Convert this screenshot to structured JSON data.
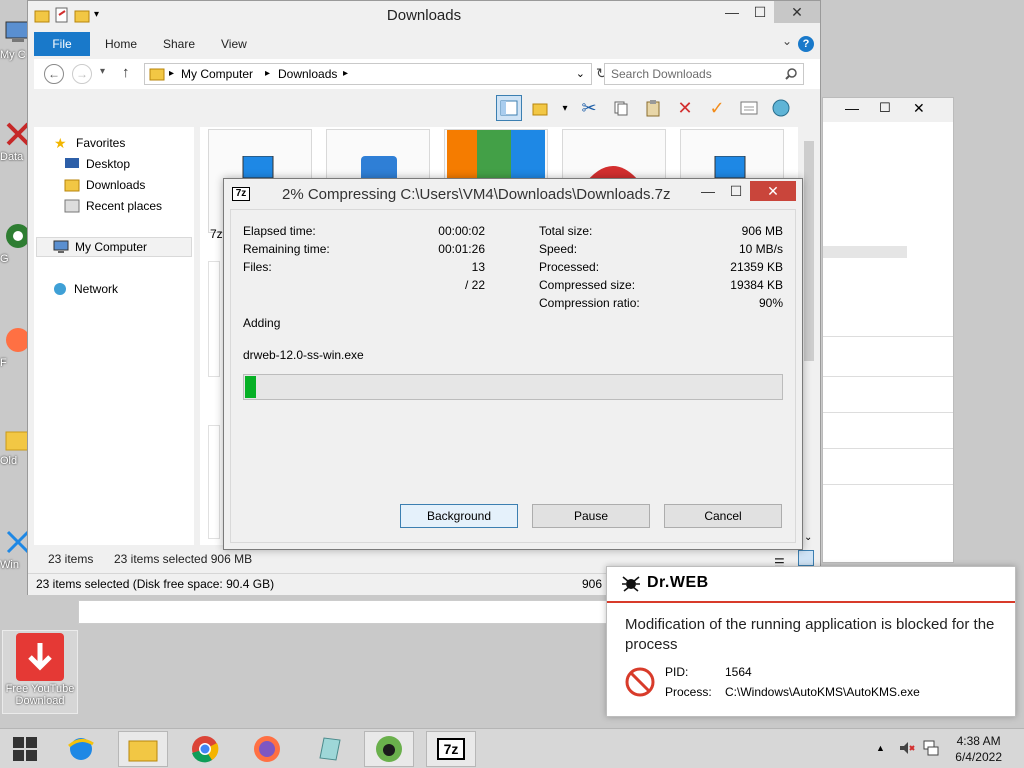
{
  "desktop": {
    "icons": [
      "My C",
      "Data",
      "G",
      "F",
      "Old",
      "Win"
    ],
    "youtube_label": "Free YouTube Download"
  },
  "explorer": {
    "title": "Downloads",
    "ribbon_tabs": [
      "File",
      "Home",
      "Share",
      "View"
    ],
    "address": {
      "crumb1": "My Computer",
      "crumb2": "Downloads"
    },
    "search_placeholder": "Search Downloads",
    "nav": {
      "favorites": "Favorites",
      "desktop": "Desktop",
      "downloads": "Downloads",
      "recent": "Recent places",
      "my_computer": "My Computer",
      "network": "Network"
    },
    "partial_label": "7z",
    "status_items": "23 items",
    "status_selected": "23 items selected  906 MB",
    "status_bar_left": "23 items selected (Disk free space: 90.4 GB)",
    "status_bar_right": "906 I"
  },
  "sevenzip": {
    "title": "2% Compressing C:\\Users\\VM4\\Downloads\\Downloads.7z",
    "logo": "7z",
    "left": {
      "elapsed_label": "Elapsed time:",
      "elapsed_value": "00:00:02",
      "remaining_label": "Remaining time:",
      "remaining_value": "00:01:26",
      "files_label": "Files:",
      "files_value": "13",
      "files_total": "/ 22"
    },
    "right": {
      "total_label": "Total size:",
      "total_value": "906 MB",
      "speed_label": "Speed:",
      "speed_value": "10 MB/s",
      "processed_label": "Processed:",
      "processed_value": "21359 KB",
      "compressed_label": "Compressed size:",
      "compressed_value": "19384 KB",
      "ratio_label": "Compression ratio:",
      "ratio_value": "90%"
    },
    "action": "Adding",
    "current_file": "drweb-12.0-ss-win.exe",
    "progress_percent": 2,
    "buttons": {
      "background": "Background",
      "pause": "Pause",
      "cancel": "Cancel"
    }
  },
  "drweb": {
    "brand": "Dr.WEB",
    "message": "Modification of the running application is blocked for the process",
    "pid_label": "PID:",
    "pid_value": "1564",
    "process_label": "Process:",
    "process_value": "C:\\Windows\\AutoKMS\\AutoKMS.exe"
  },
  "taskbar": {
    "time": "4:38 AM",
    "date": "6/4/2022"
  },
  "colors": {
    "ribbon_file": "#1979ca",
    "progress": "#06b025",
    "drweb_accent": "#d83b2a",
    "zip_close": "#c9453b"
  }
}
